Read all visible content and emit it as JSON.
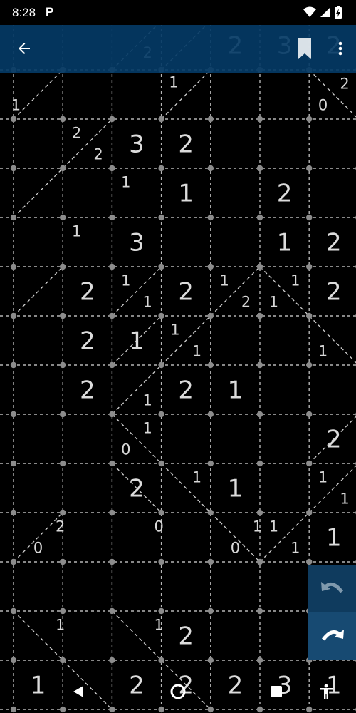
{
  "status_bar": {
    "time": "8:28",
    "notification_letter": "P",
    "icons": [
      "wifi-icon",
      "cell-signal-icon",
      "battery-charging-icon"
    ]
  },
  "app_bar": {
    "back_icon": "arrow-left-icon",
    "bookmark_icon": "bookmark-icon",
    "menu_icon": "more-vertical-icon",
    "background_color": "#043a65"
  },
  "puzzle": {
    "type": "slant",
    "rows": 14,
    "cols": 7,
    "cell_clues": [
      {
        "row": 0,
        "col": 4,
        "value": "2"
      },
      {
        "row": 0,
        "col": 5,
        "value": "3"
      },
      {
        "row": 0,
        "col": 6,
        "value": "2"
      },
      {
        "row": 2,
        "col": 2,
        "value": "3"
      },
      {
        "row": 2,
        "col": 3,
        "value": "2"
      },
      {
        "row": 3,
        "col": 3,
        "value": "1"
      },
      {
        "row": 3,
        "col": 5,
        "value": "2"
      },
      {
        "row": 4,
        "col": 2,
        "value": "3"
      },
      {
        "row": 4,
        "col": 5,
        "value": "1"
      },
      {
        "row": 4,
        "col": 6,
        "value": "2"
      },
      {
        "row": 5,
        "col": 1,
        "value": "2"
      },
      {
        "row": 5,
        "col": 3,
        "value": "2"
      },
      {
        "row": 5,
        "col": 6,
        "value": "2"
      },
      {
        "row": 6,
        "col": 1,
        "value": "2"
      },
      {
        "row": 6,
        "col": 2,
        "value": "1"
      },
      {
        "row": 7,
        "col": 1,
        "value": "2"
      },
      {
        "row": 7,
        "col": 3,
        "value": "2"
      },
      {
        "row": 7,
        "col": 4,
        "value": "1"
      },
      {
        "row": 8,
        "col": 6,
        "value": "2"
      },
      {
        "row": 9,
        "col": 2,
        "value": "2"
      },
      {
        "row": 9,
        "col": 4,
        "value": "1"
      },
      {
        "row": 10,
        "col": 6,
        "value": "1"
      },
      {
        "row": 12,
        "col": 3,
        "value": "2"
      },
      {
        "row": 13,
        "col": 0,
        "value": "1"
      },
      {
        "row": 13,
        "col": 2,
        "value": "2"
      },
      {
        "row": 13,
        "col": 3,
        "value": "2"
      },
      {
        "row": 13,
        "col": 4,
        "value": "2"
      },
      {
        "row": 13,
        "col": 5,
        "value": "3"
      },
      {
        "row": 13,
        "col": 6,
        "value": "1"
      }
    ],
    "corner_clues": [
      {
        "r": 0.65,
        "c": 2.72,
        "value": "2"
      },
      {
        "r": 1.25,
        "c": 3.25,
        "value": "1"
      },
      {
        "r": 1.72,
        "c": 0.05,
        "value": "1"
      },
      {
        "r": 1.28,
        "c": 6.72,
        "value": "2"
      },
      {
        "r": 1.72,
        "c": 6.28,
        "value": "0"
      },
      {
        "r": 2.28,
        "c": 1.28,
        "value": "2"
      },
      {
        "r": 2.72,
        "c": 1.72,
        "value": "2"
      },
      {
        "r": 3.28,
        "c": 2.28,
        "value": "1"
      },
      {
        "r": 4.28,
        "c": 1.28,
        "value": "1"
      },
      {
        "r": 5.28,
        "c": 2.28,
        "value": "1"
      },
      {
        "r": 5.72,
        "c": 2.72,
        "value": "1"
      },
      {
        "r": 5.28,
        "c": 4.28,
        "value": "1"
      },
      {
        "r": 5.72,
        "c": 4.72,
        "value": "2"
      },
      {
        "r": 5.72,
        "c": 5.28,
        "value": "1"
      },
      {
        "r": 5.28,
        "c": 5.72,
        "value": "1"
      },
      {
        "r": 6.28,
        "c": 3.28,
        "value": "1"
      },
      {
        "r": 6.72,
        "c": 3.72,
        "value": "1"
      },
      {
        "r": 6.72,
        "c": 6.28,
        "value": "1"
      },
      {
        "r": 7.72,
        "c": 2.72,
        "value": "1"
      },
      {
        "r": 8.28,
        "c": 2.72,
        "value": "1"
      },
      {
        "r": 8.72,
        "c": 2.28,
        "value": "0"
      },
      {
        "r": 9.28,
        "c": 3.72,
        "value": "1"
      },
      {
        "r": 9.28,
        "c": 6.28,
        "value": "1"
      },
      {
        "r": 9.72,
        "c": 6.72,
        "value": "1"
      },
      {
        "r": 10.28,
        "c": 0.95,
        "value": "2"
      },
      {
        "r": 10.72,
        "c": 0.5,
        "value": "0"
      },
      {
        "r": 10.28,
        "c": 2.95,
        "value": "0"
      },
      {
        "r": 10.28,
        "c": 4.95,
        "value": "1"
      },
      {
        "r": 10.72,
        "c": 4.5,
        "value": "0"
      },
      {
        "r": 10.28,
        "c": 5.28,
        "value": "1"
      },
      {
        "r": 10.72,
        "c": 5.72,
        "value": "1"
      },
      {
        "r": 12.28,
        "c": 0.95,
        "value": "1"
      },
      {
        "r": 12.28,
        "c": 2.95,
        "value": "1"
      }
    ],
    "diagonals": [
      {
        "r": 0,
        "c": 2,
        "d": "f"
      },
      {
        "r": 0,
        "c": 3,
        "d": "f"
      },
      {
        "r": 1,
        "c": 0,
        "d": "f"
      },
      {
        "r": 1,
        "c": 3,
        "d": "f"
      },
      {
        "r": 1,
        "c": 6,
        "d": "b"
      },
      {
        "r": 2,
        "c": 1,
        "d": "f"
      },
      {
        "r": 3,
        "c": 0,
        "d": "f"
      },
      {
        "r": 5,
        "c": 0,
        "d": "f"
      },
      {
        "r": 5,
        "c": 2,
        "d": "f"
      },
      {
        "r": 5,
        "c": 4,
        "d": "f"
      },
      {
        "r": 5,
        "c": 5,
        "d": "b"
      },
      {
        "r": 6,
        "c": 2,
        "d": "f"
      },
      {
        "r": 6,
        "c": 3,
        "d": "f"
      },
      {
        "r": 6,
        "c": 6,
        "d": "b"
      },
      {
        "r": 7,
        "c": 2,
        "d": "f"
      },
      {
        "r": 8,
        "c": 2,
        "d": "b"
      },
      {
        "r": 8,
        "c": 6,
        "d": "f"
      },
      {
        "r": 9,
        "c": 2,
        "d": "b"
      },
      {
        "r": 9,
        "c": 3,
        "d": "b"
      },
      {
        "r": 9,
        "c": 6,
        "d": "f"
      },
      {
        "r": 10,
        "c": 0,
        "d": "f"
      },
      {
        "r": 10,
        "c": 4,
        "d": "b"
      },
      {
        "r": 10,
        "c": 5,
        "d": "f"
      },
      {
        "r": 12,
        "c": 0,
        "d": "b"
      },
      {
        "r": 12,
        "c": 2,
        "d": "b"
      },
      {
        "r": 13,
        "c": 1,
        "d": "b"
      },
      {
        "r": 13,
        "c": 3,
        "d": "b"
      }
    ]
  },
  "fab": {
    "undo_icon": "undo-icon",
    "redo_icon": "redo-icon",
    "undo_color": "#0f3b5e",
    "redo_color": "#174a72"
  },
  "nav_bar": {
    "back_icon": "nav-back-triangle-icon",
    "home_icon": "nav-home-circle-icon",
    "recents_icon": "nav-recents-square-icon",
    "accessibility_icon": "accessibility-icon"
  }
}
